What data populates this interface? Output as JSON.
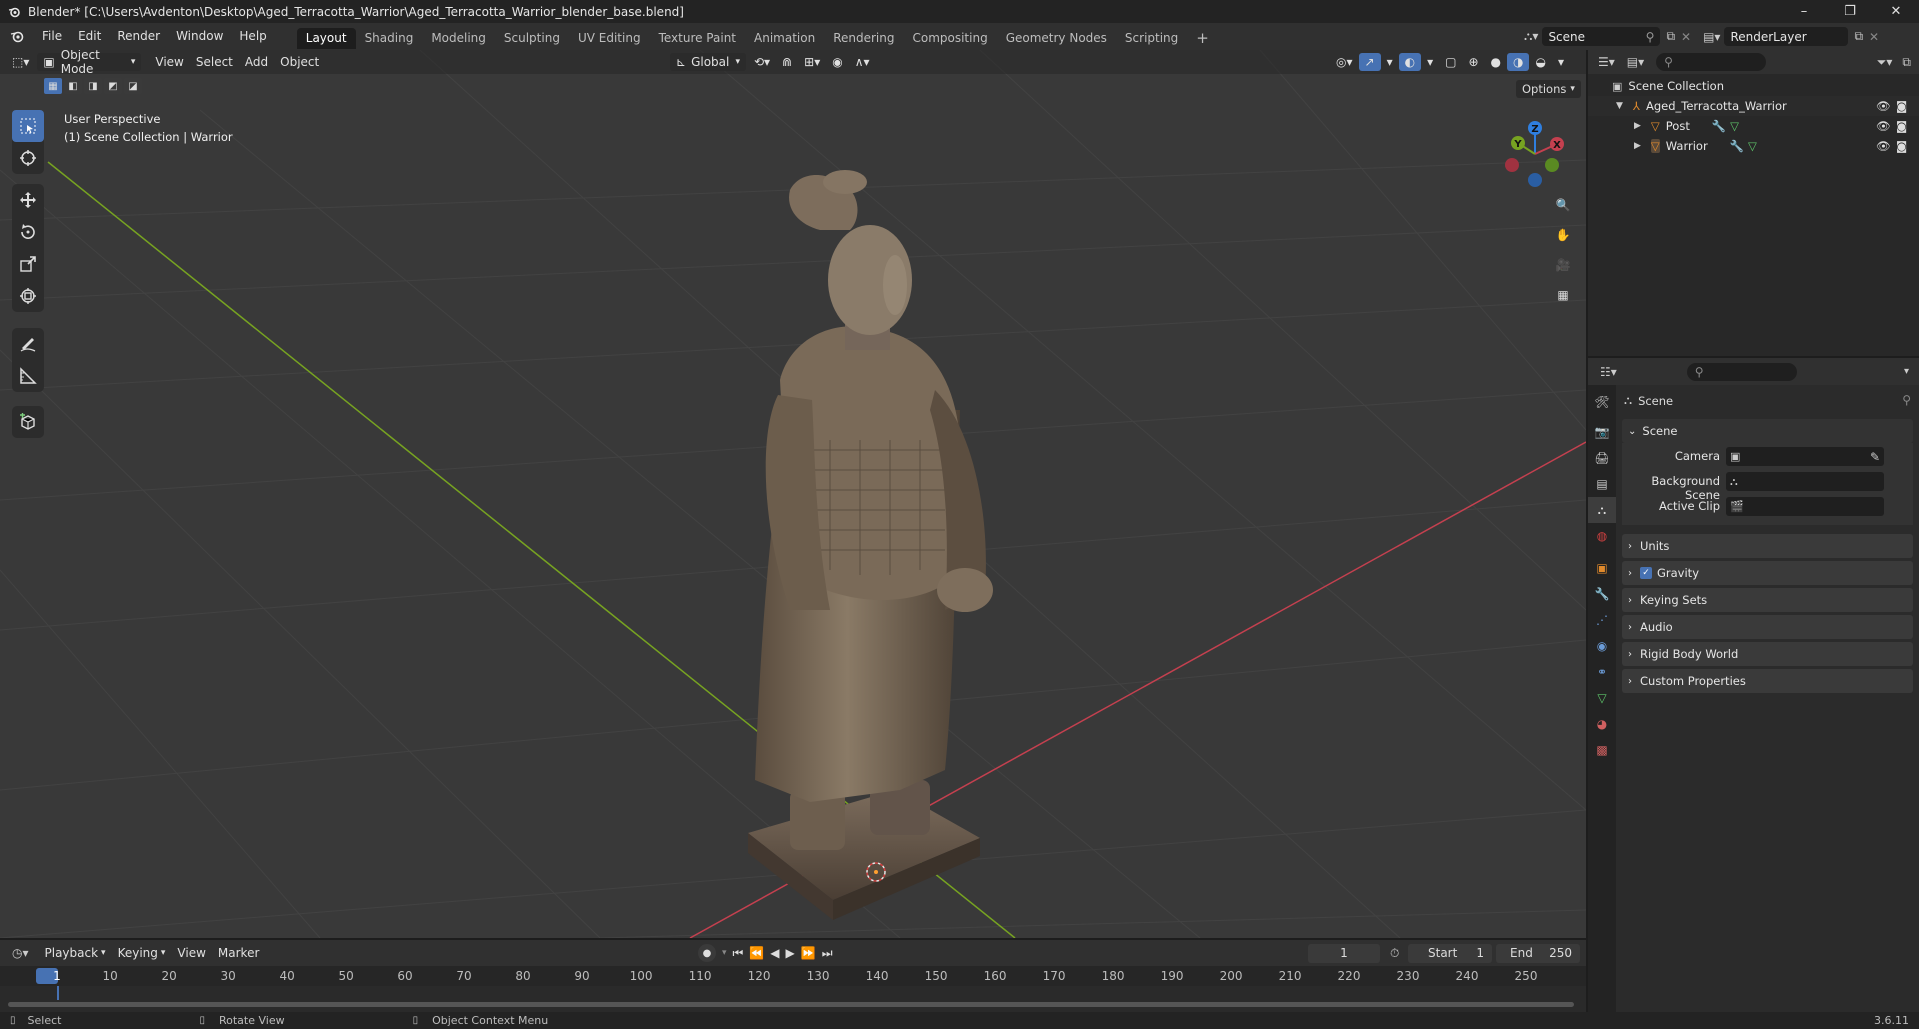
{
  "titlebar": {
    "title": "Blender* [C:\\Users\\Avdenton\\Desktop\\Aged_Terracotta_Warrior\\Aged_Terracotta_Warrior_blender_base.blend]",
    "minimize": "–",
    "maximize": "❐",
    "close": "✕"
  },
  "menu": {
    "items": [
      "File",
      "Edit",
      "Render",
      "Window",
      "Help"
    ]
  },
  "workspaces": {
    "tabs": [
      "Layout",
      "Shading",
      "Modeling",
      "Sculpting",
      "UV Editing",
      "Texture Paint",
      "Animation",
      "Rendering",
      "Compositing",
      "Geometry Nodes",
      "Scripting"
    ],
    "add": "+"
  },
  "scene_selector": {
    "value": "Scene"
  },
  "layer_selector": {
    "value": "RenderLayer"
  },
  "viewport": {
    "mode": "Object Mode",
    "menus": [
      "View",
      "Select",
      "Add",
      "Object"
    ],
    "orientation": "Global",
    "options": "Options",
    "info_line1": "User Perspective",
    "info_line2": "(1) Scene Collection | Warrior",
    "gizmo": {
      "x": "X",
      "y": "Y",
      "z": "Z"
    }
  },
  "outliner": {
    "root": "Scene Collection",
    "collection": "Aged_Terracotta_Warrior",
    "objects": [
      "Post",
      "Warrior"
    ]
  },
  "properties": {
    "context": "Scene",
    "panel_scene": "Scene",
    "camera_label": "Camera",
    "bg_scene_label": "Background Scene",
    "active_clip_label": "Active Clip",
    "panels": [
      "Units",
      "Gravity",
      "Keying Sets",
      "Audio",
      "Rigid Body World",
      "Custom Properties"
    ]
  },
  "timeline": {
    "menus": [
      "Playback",
      "Keying",
      "View",
      "Marker"
    ],
    "current_frame": "1",
    "start_label": "Start",
    "start_value": "1",
    "end_label": "End",
    "end_value": "250",
    "ticks": [
      "1",
      "10",
      "20",
      "30",
      "40",
      "50",
      "60",
      "70",
      "80",
      "90",
      "100",
      "110",
      "120",
      "130",
      "140",
      "150",
      "160",
      "170",
      "180",
      "190",
      "200",
      "210",
      "220",
      "230",
      "240",
      "250"
    ]
  },
  "statusbar": {
    "select": "Select",
    "rotate": "Rotate View",
    "context_menu": "Object Context Menu",
    "version": "3.6.11"
  },
  "colors": {
    "accent": "#4772b3",
    "x_axis": "#c4404f",
    "y_axis": "#77a321",
    "z_axis": "#2f7fe0"
  }
}
